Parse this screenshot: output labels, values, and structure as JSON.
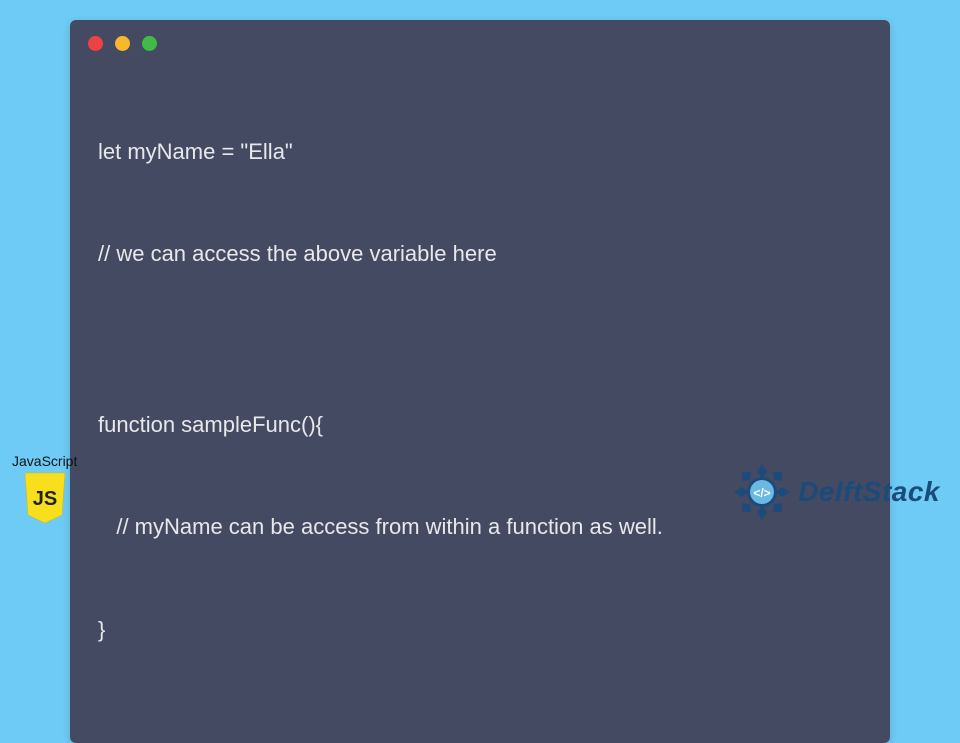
{
  "code": {
    "lines": [
      "let myName = \"Ella\"",
      "// we can access the above variable here",
      "",
      "function sampleFunc(){",
      "   // myName can be access from within a function as well.",
      "}"
    ]
  },
  "jsBadge": {
    "label": "JavaScript",
    "iconText": "JS"
  },
  "brand": {
    "name": "DelftStack",
    "iconGlyph": "</>"
  },
  "colors": {
    "pageBg": "#6ecbf5",
    "windowBg": "#454a63",
    "codeText": "#e8e8ea",
    "jsYellow": "#f7df1e",
    "delftBlue": "#1b4b7a"
  }
}
